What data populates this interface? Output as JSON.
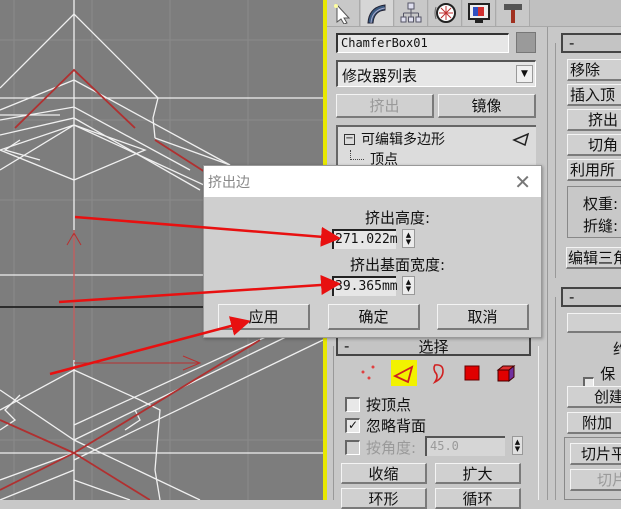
{
  "toolbar": {
    "tabs": [
      {
        "icon": "create-icon",
        "label": "Create"
      },
      {
        "icon": "modify-icon",
        "label": "Modify"
      },
      {
        "icon": "hierarchy-icon",
        "label": "Hierarchy"
      },
      {
        "icon": "motion-icon",
        "label": "Motion"
      },
      {
        "icon": "display-icon",
        "label": "Display"
      },
      {
        "icon": "utilities-icon",
        "label": "Utilities"
      }
    ]
  },
  "object": {
    "name": "ChamferBox01",
    "color": "#9a9a9a"
  },
  "modifier_list": {
    "selected": "修改器列表"
  },
  "top_buttons": {
    "extrude": "挤出",
    "mirror": "镜像"
  },
  "stack": {
    "expand": "⊟",
    "item": "可编辑多边形",
    "sub_item": "顶点"
  },
  "right_column": {
    "collapse": "-",
    "buttons": [
      "移除",
      "插入顶",
      "挤出",
      "切角",
      "利用所"
    ],
    "group_labels": [
      "权重:",
      "折缝:"
    ],
    "edit_tri": "编辑三角",
    "collapse2": "-",
    "label_fragment": "约",
    "keep_label": "保持",
    "create_btn": "创建",
    "attach_btn": "附加",
    "slice_plane": "切片平",
    "slice": "切片"
  },
  "selection_rollout": {
    "collapse": "-",
    "title": "选择",
    "levels": [
      "vertex",
      "edge",
      "border",
      "polygon",
      "element"
    ],
    "active_level": "edge",
    "by_vertex": {
      "label": "按顶点",
      "checked": false
    },
    "ignore_backfacing": {
      "label": "忽略背面",
      "checked": true
    },
    "by_angle": {
      "label": "按角度:",
      "checked": false,
      "value": "45.0"
    },
    "shrink": "收缩",
    "grow": "扩大",
    "ring": "环形",
    "loop": "循环"
  },
  "dialog": {
    "title": "挤出边",
    "height_label": "挤出高度:",
    "height_value": "271.022m",
    "width_label": "挤出基面宽度:",
    "width_value": "39.365mm",
    "apply": "应用",
    "ok": "确定",
    "cancel": "取消"
  },
  "colors": {
    "viewport_bg": "#7d7d7d",
    "wire": "#f0f0f0",
    "selected_edge": "#b03030",
    "annotation": "#e81010",
    "active_level": "#f2f200"
  }
}
